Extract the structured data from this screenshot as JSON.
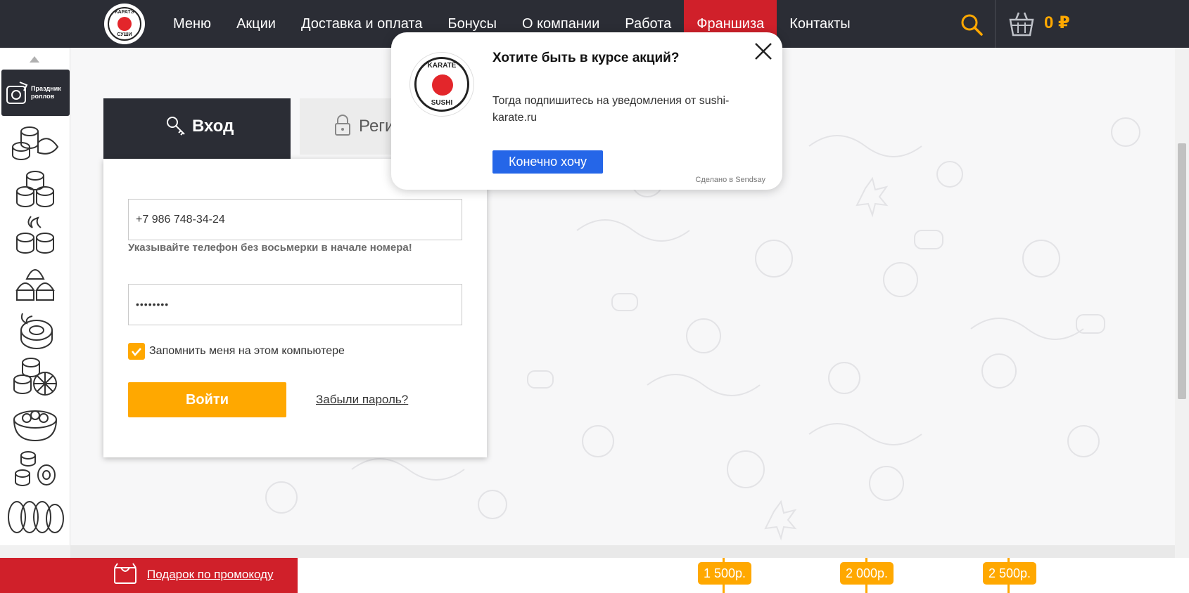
{
  "header": {
    "logo_top": "КАРАТЭ",
    "logo_bottom": "СУШИ",
    "nav": [
      {
        "label": "Меню"
      },
      {
        "label": "Акции"
      },
      {
        "label": "Доставка и оплата"
      },
      {
        "label": "Бонусы"
      },
      {
        "label": "О компании"
      },
      {
        "label": "Работа"
      },
      {
        "label": "Франшиза",
        "active": true
      },
      {
        "label": "Контакты"
      }
    ],
    "cart_total": "0 ₽"
  },
  "sidebar": {
    "promo_label": "Праздник роллов",
    "icons": [
      "sushi-set-icon",
      "rolls-icon",
      "hot-rolls-icon",
      "baked-rolls-icon",
      "tempura-roll-icon",
      "lemon-rolls-icon",
      "bowl-icon",
      "mini-rolls-icon",
      "fried-rolls-icon"
    ]
  },
  "login": {
    "tab_login": "Вход",
    "tab_register": "Реги",
    "phone_value": "+7 986 748-34-24",
    "phone_hint": "Указывайте телефон без восьмерки в начале номера!",
    "password_value": "••••••••",
    "remember_label": "Запомнить меня на этом компьютере",
    "submit_label": "Войти",
    "forgot_label": "Забыли пароль?"
  },
  "popup": {
    "logo_top": "KARATE",
    "logo_bottom": "SUSHI",
    "title": "Хотите быть в курсе акций?",
    "text": "Тогда подпишитесь на уведомления от sushi-karate.ru",
    "button": "Конечно хочу",
    "credit": "Сделано в Sendsay"
  },
  "footer": {
    "promo_label": "Подарок по промокоду",
    "tiers": [
      "1 500р.",
      "2 000р.",
      "2 500р."
    ]
  },
  "colors": {
    "dark": "#2b2d35",
    "red": "#d0202a",
    "accent": "#ffa800",
    "blue": "#2566e8"
  }
}
